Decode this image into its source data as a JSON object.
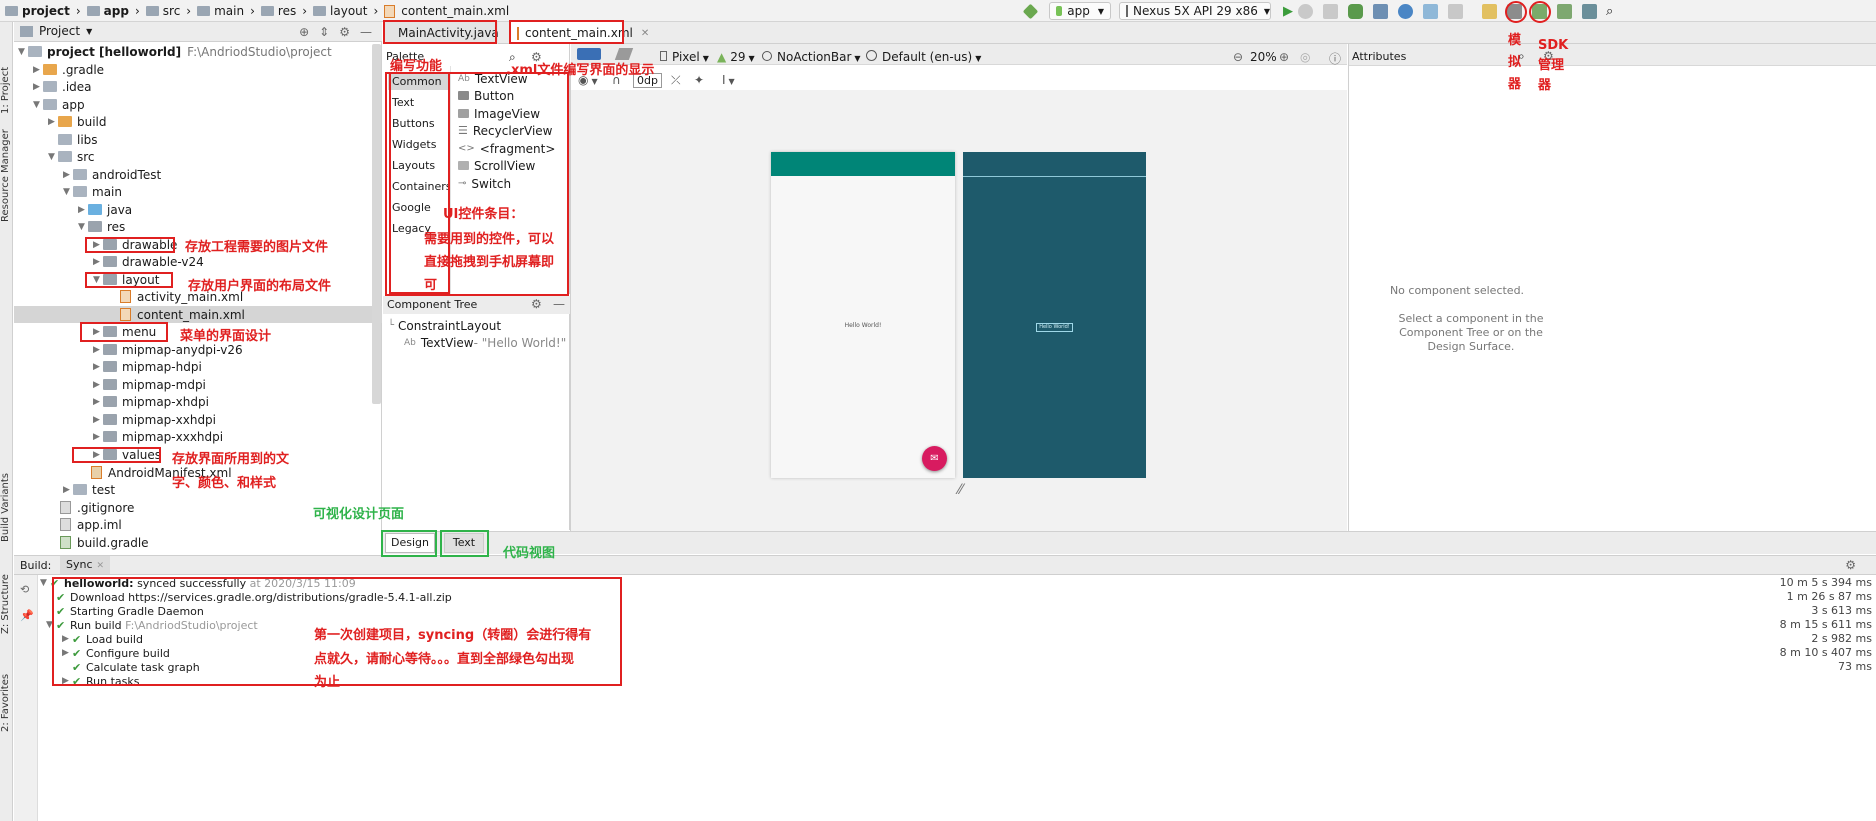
{
  "navbar": {
    "crumbs": [
      "project",
      "app",
      "src",
      "main",
      "res",
      "layout",
      "content_main.xml"
    ],
    "run_config": "app",
    "device": "Nexus 5X API 29 x86"
  },
  "left_stripe": {
    "project": "1: Project",
    "resource_manager": "Resource Manager",
    "build_variants": "Build Variants",
    "structure": "Z: Structure",
    "favorites": "2: Favorites"
  },
  "project_panel": {
    "title": "Project",
    "root_name": "project [helloworld]",
    "root_path": "F:\\AndriodStudio\\project",
    "items": [
      ".gradle",
      ".idea",
      "app",
      "build",
      "libs",
      "src",
      "androidTest",
      "main",
      "java",
      "res",
      "drawable",
      "drawable-v24",
      "layout",
      "activity_main.xml",
      "content_main.xml",
      "menu",
      "mipmap-anydpi-v26",
      "mipmap-hdpi",
      "mipmap-mdpi",
      "mipmap-xhdpi",
      "mipmap-xxhdpi",
      "mipmap-xxxhdpi",
      "values",
      "AndroidManifest.xml",
      "test",
      ".gitignore",
      "app.iml",
      "build.gradle"
    ]
  },
  "editor_tabs": [
    "MainActivity.java",
    "content_main.xml"
  ],
  "palette": {
    "title": "Palette",
    "categories": [
      "Common",
      "Text",
      "Buttons",
      "Widgets",
      "Layouts",
      "Containers",
      "Google",
      "Legacy"
    ],
    "items": [
      "TextView",
      "Button",
      "ImageView",
      "RecyclerView",
      "<fragment>",
      "ScrollView",
      "Switch"
    ]
  },
  "component_tree": {
    "title": "Component Tree",
    "root": "ConstraintLayout",
    "child": "TextView",
    "child_value": "- \"Hello World!\""
  },
  "design_toolbar": {
    "device": "Pixel",
    "api": "29",
    "theme": "NoActionBar",
    "locale": "Default (en-us)",
    "zoom": "20%",
    "margin": "0dp"
  },
  "canvas": {
    "hello": "Hello World!",
    "primary_color": "#008577",
    "blueprint_color": "#1e5a6b",
    "fab_color": "#d81b60"
  },
  "attributes": {
    "title": "Attributes",
    "empty": "No component selected.",
    "hint": "Select a component in the Component Tree or on the Design Surface."
  },
  "view_tabs": {
    "design": "Design",
    "text": "Text"
  },
  "build": {
    "title": "Build:",
    "tab": "Sync",
    "rows": [
      {
        "text": "helloworld:",
        "extra": "synced successfully",
        "muted": "at 2020/3/15 11:09",
        "time": "10 m 5 s 394 ms"
      },
      {
        "text": "Download https://services.gradle.org/distributions/gradle-5.4.1-all.zip",
        "extra": "",
        "muted": "",
        "time": "1 m 26 s 87 ms"
      },
      {
        "text": "Starting Gradle Daemon",
        "extra": "",
        "muted": "",
        "time": "3 s 613 ms"
      },
      {
        "text": "Run build",
        "extra": "",
        "muted": "F:\\AndriodStudio\\project",
        "time": "8 m 15 s 611 ms"
      },
      {
        "text": "Load build",
        "extra": "",
        "muted": "",
        "time": "2 s 982 ms"
      },
      {
        "text": "Configure build",
        "extra": "",
        "muted": "",
        "time": "8 m 10 s 407 ms"
      },
      {
        "text": "Calculate task graph",
        "extra": "",
        "muted": "",
        "time": "73 ms"
      },
      {
        "text": "Run tasks",
        "extra": "",
        "muted": "",
        "time": ""
      }
    ]
  },
  "annotations": {
    "palette_func": "编写功能",
    "xml_display": ".xml文件编写界面的显示",
    "ui_widgets_1": "UI控件条目：",
    "ui_widgets_2": "需要用到的控件，可以",
    "ui_widgets_3": "直接拖拽到手机屏幕即",
    "ui_widgets_4": "可",
    "drawable": "存放工程需要的图片文件",
    "layout": "存放用户界面的布局文件",
    "menu": "菜单的界面设计",
    "values_1": "存放界面所用到的文",
    "values_2": "字、颜色、和样式",
    "visual_design": "可视化设计页面",
    "code_view": "代码视图",
    "sync_1": "第一次创建项目，syncing（转圈）会进行得有",
    "sync_2": "点就久，请耐心等待。。。直到全部绿色勾出现",
    "sync_3": "为止",
    "emulator": "模拟器",
    "sdk": "SDK管理器"
  }
}
